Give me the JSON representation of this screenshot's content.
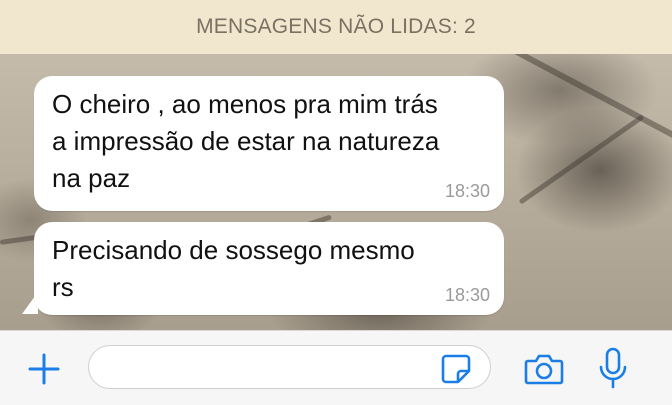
{
  "banner": {
    "unread_label": "MENSAGENS NÃO LIDAS: 2"
  },
  "messages": [
    {
      "text": "O cheiro , ao menos pra mim trás\na impressão de estar na natureza\nna paz",
      "time": "18:30"
    },
    {
      "text": "Precisando de sossego mesmo\nrs",
      "time": "18:30"
    }
  ],
  "input_bar": {
    "message_value": "",
    "icons": [
      "plus-icon",
      "sticker-icon",
      "camera-icon",
      "microphone-icon"
    ],
    "accent_color": "#1a7ee6"
  },
  "colors": {
    "banner_bg": "#f1e7cf",
    "bubble_bg": "#ffffff",
    "timestamp": "#9a9a9a"
  }
}
